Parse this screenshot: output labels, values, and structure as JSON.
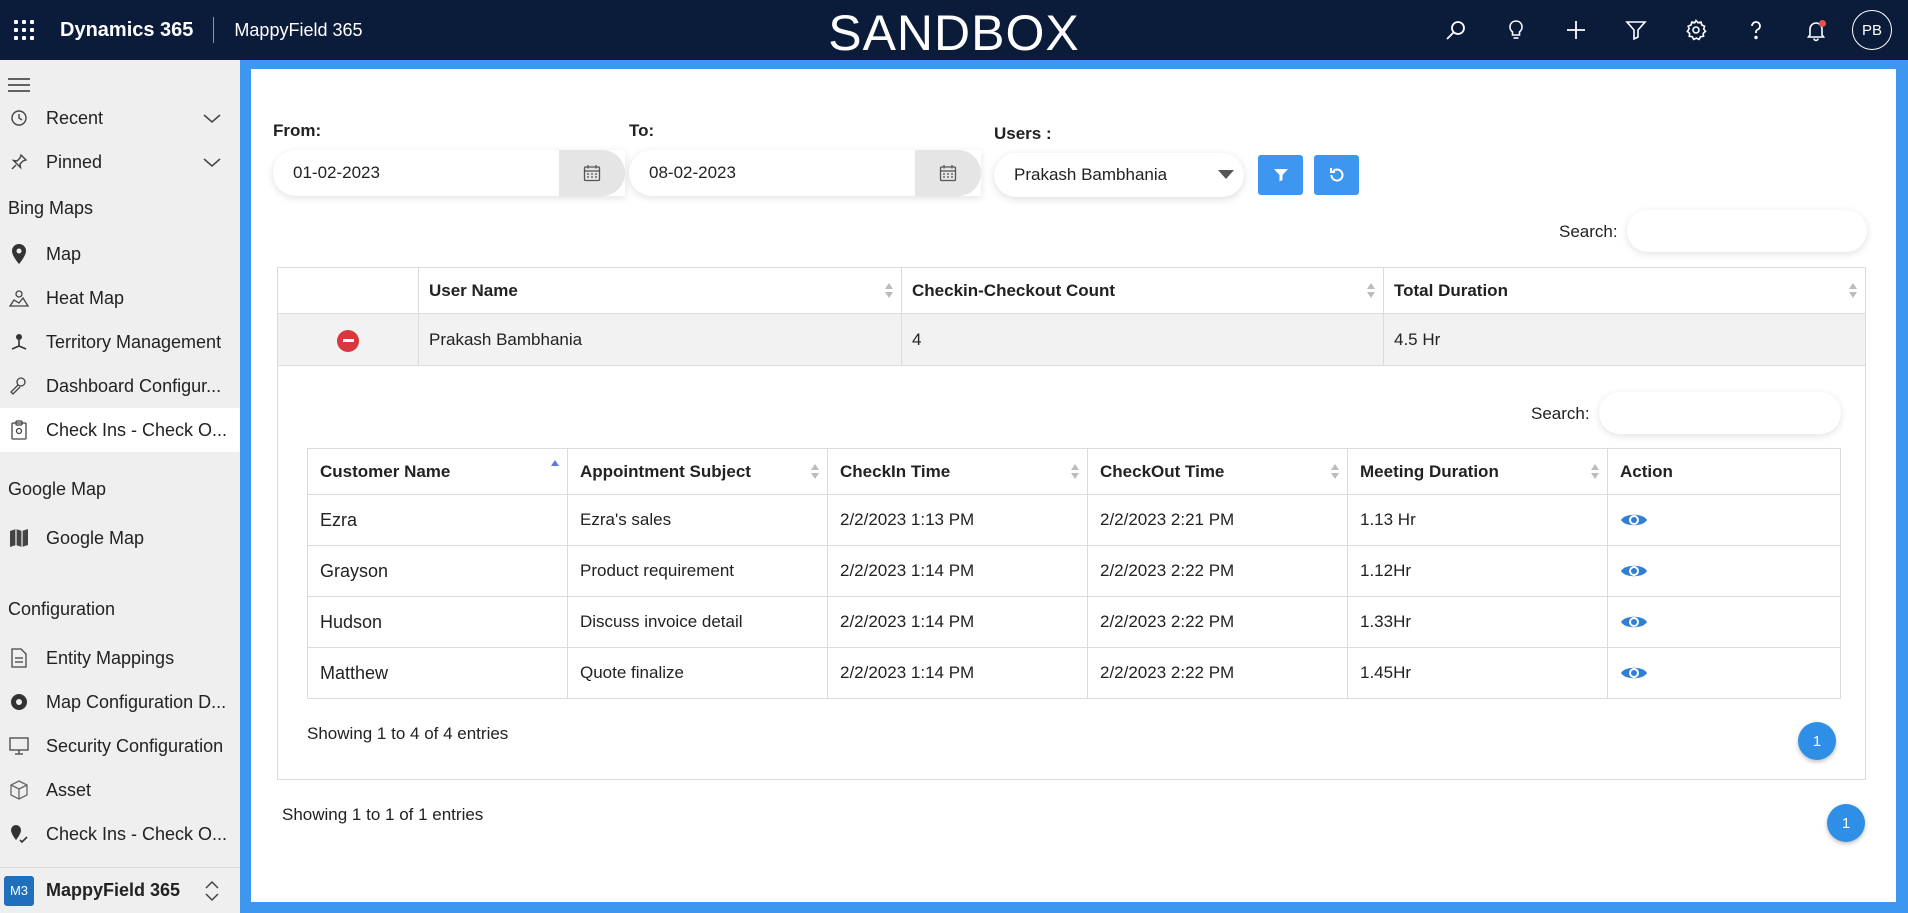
{
  "header": {
    "brand": "Dynamics 365",
    "app_name": "MappyField 365",
    "environment": "SANDBOX",
    "avatar_initials": "PB",
    "icons": [
      "search-icon",
      "lightbulb-icon",
      "plus-icon",
      "filter-icon",
      "gear-icon",
      "help-icon",
      "bell-icon"
    ]
  },
  "sidebar": {
    "items": [
      {
        "label": "Recent",
        "icon": "clock-icon"
      },
      {
        "label": "Pinned",
        "icon": "pin-icon"
      }
    ],
    "groups": [
      {
        "title": "Bing Maps",
        "items": [
          {
            "label": "Map",
            "icon": "map-pin-icon"
          },
          {
            "label": "Heat Map",
            "icon": "heat-map-icon"
          },
          {
            "label": "Territory Management",
            "icon": "territory-icon"
          },
          {
            "label": "Dashboard Configur...",
            "icon": "dashboard-config-icon"
          },
          {
            "label": "Check Ins - Check O...",
            "icon": "clipboard-icon"
          }
        ]
      },
      {
        "title": "Google Map",
        "items": [
          {
            "label": "Google Map",
            "icon": "folded-map-icon"
          }
        ]
      },
      {
        "title": "Configuration",
        "items": [
          {
            "label": "Entity Mappings",
            "icon": "document-icon"
          },
          {
            "label": "Map Configuration D...",
            "icon": "gear-icon"
          },
          {
            "label": "Security Configuration",
            "icon": "monitor-icon"
          },
          {
            "label": "Asset",
            "icon": "box-icon"
          },
          {
            "label": "Check Ins - Check O...",
            "icon": "map-check-icon"
          }
        ]
      }
    ],
    "app_switcher": {
      "badge": "M3",
      "title": "MappyField 365"
    }
  },
  "filters": {
    "from_label": "From:",
    "from_value": "01-02-2023",
    "to_label": "To:",
    "to_value": "08-02-2023",
    "users_label": "Users :",
    "users_value": "Prakash Bambhania",
    "search_label": "Search:"
  },
  "outer_table": {
    "columns": [
      "User Name",
      "Checkin-Checkout Count",
      "Total Duration"
    ],
    "row": {
      "user": "Prakash Bambhania",
      "count": "4",
      "duration": "4.5 Hr"
    },
    "info": "Showing 1 to 1 of 1 entries",
    "page": "1"
  },
  "inner_table": {
    "search_label": "Search:",
    "columns": [
      "Customer Name",
      "Appointment Subject",
      "CheckIn Time",
      "CheckOut Time",
      "Meeting Duration",
      "Action"
    ],
    "rows": [
      {
        "customer": "Ezra",
        "subject": "Ezra's sales",
        "checkin": "2/2/2023 1:13 PM",
        "checkout": "2/2/2023 2:21 PM",
        "duration": "1.13 Hr"
      },
      {
        "customer": "Grayson",
        "subject": "Product requirement",
        "checkin": "2/2/2023 1:14 PM",
        "checkout": "2/2/2023 2:22 PM",
        "duration": "1.12Hr"
      },
      {
        "customer": "Hudson",
        "subject": "Discuss invoice detail",
        "checkin": "2/2/2023 1:14 PM",
        "checkout": "2/2/2023 2:22 PM",
        "duration": "1.33Hr"
      },
      {
        "customer": "Matthew",
        "subject": "Quote finalize",
        "checkin": "2/2/2023 1:14 PM",
        "checkout": "2/2/2023 2:22 PM",
        "duration": "1.45Hr"
      }
    ],
    "info": "Showing 1 to 4 of 4 entries",
    "page": "1"
  },
  "colors": {
    "topbar": "#0b1b3a",
    "accent": "#3d97f0",
    "remove": "#d9363e",
    "eye": "#2f7fd6"
  }
}
